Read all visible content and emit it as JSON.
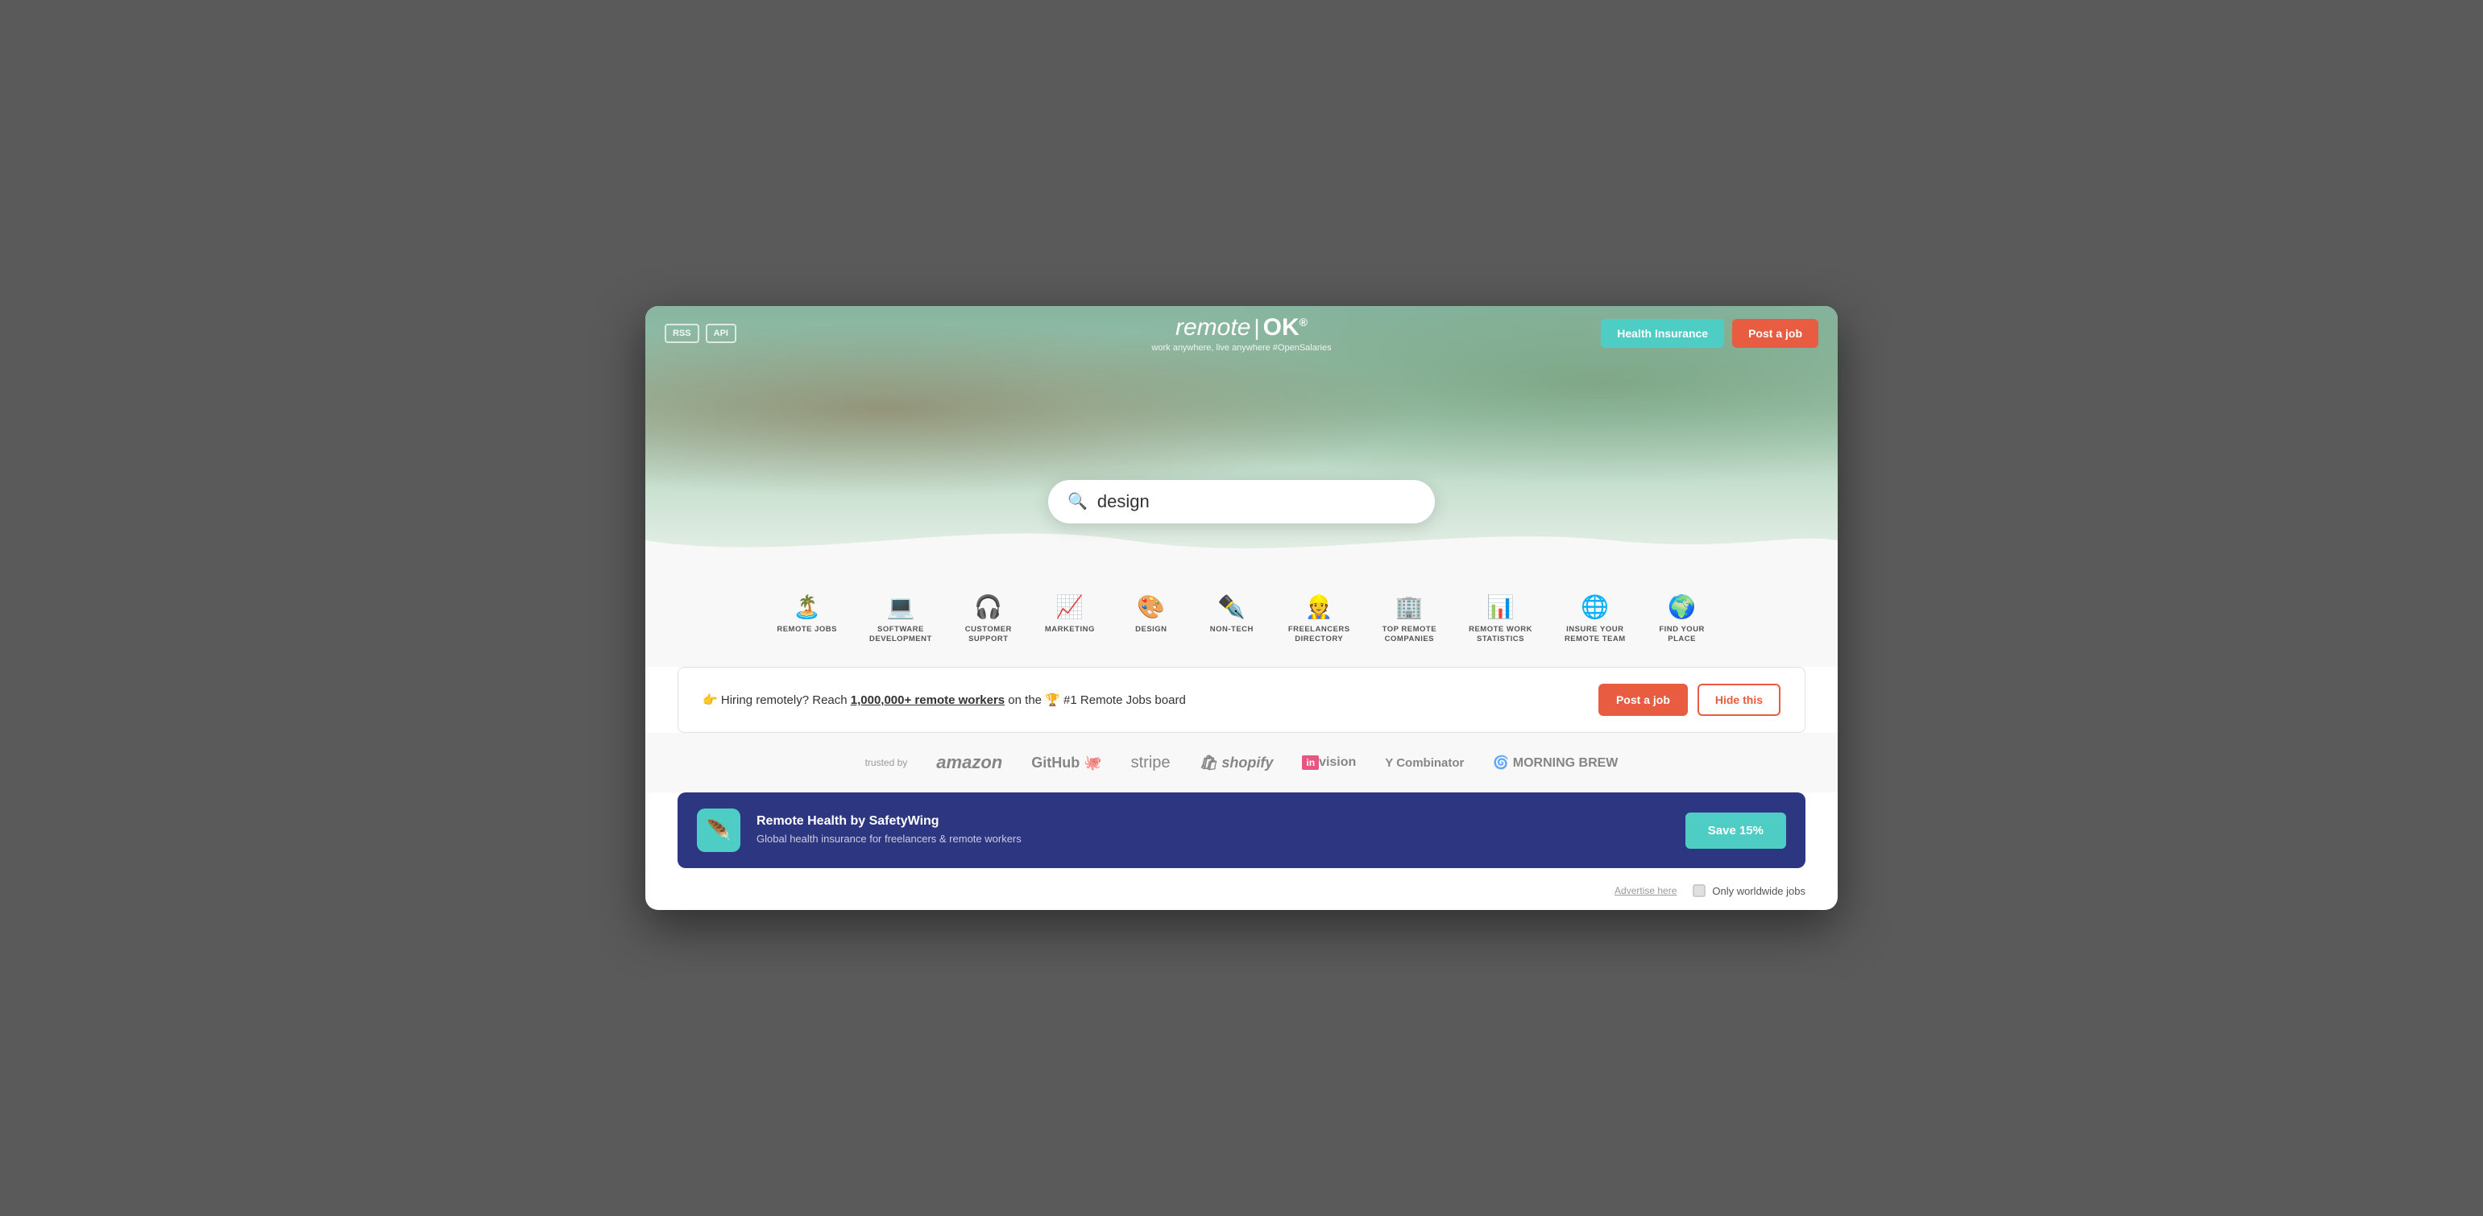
{
  "header": {
    "rss_label": "RSS",
    "api_label": "API",
    "logo_text": "remote",
    "logo_pipe": "|",
    "logo_ok": "OK",
    "logo_tm": "®",
    "tagline": "work anywhere, live anywhere #OpenSalaries",
    "health_insurance_label": "Health Insurance",
    "post_job_label": "Post a job"
  },
  "search": {
    "placeholder": "design",
    "value": "design"
  },
  "nav_items": [
    {
      "icon": "🏝️",
      "label": "REMOTE JOBS"
    },
    {
      "icon": "💻",
      "label": "SOFTWARE DEVELOPMENT"
    },
    {
      "icon": "🎧",
      "label": "CUSTOMER SUPPORT"
    },
    {
      "icon": "📈",
      "label": "MARKETING"
    },
    {
      "icon": "🎨",
      "label": "DESIGN"
    },
    {
      "icon": "🖊️",
      "label": "NON-TECH"
    },
    {
      "icon": "👷",
      "label": "FREELANCERS DIRECTORY"
    },
    {
      "icon": "🏢",
      "label": "TOP REMOTE COMPANIES"
    },
    {
      "icon": "📊",
      "label": "REMOTE WORK STATISTICS"
    },
    {
      "icon": "🌐",
      "label": "INSURE YOUR REMOTE TEAM"
    },
    {
      "icon": "🌍",
      "label": "FIND YOUR PLACE"
    }
  ],
  "hiring_banner": {
    "emoji": "👉",
    "text": "Hiring remotely? Reach ",
    "highlight": "1,000,000+ remote workers",
    "text2": " on the ",
    "trophy": "🏆",
    "text3": " #1 Remote Jobs board",
    "post_job_label": "Post a job",
    "hide_label": "Hide this"
  },
  "trusted": {
    "label": "trusted by",
    "logos": [
      "amazon",
      "GitHub 🐙",
      "stripe",
      "shopify",
      "inVision",
      "Y Combinator",
      "🌀 MORNING BREW"
    ]
  },
  "ad": {
    "logo_icon": "🪶",
    "title": "Remote Health by SafetyWing",
    "subtitle": "Global health insurance for freelancers & remote workers",
    "cta": "Save 15%"
  },
  "footer": {
    "advertise": "Advertise here",
    "worldwide_label": "Only worldwide jobs"
  }
}
